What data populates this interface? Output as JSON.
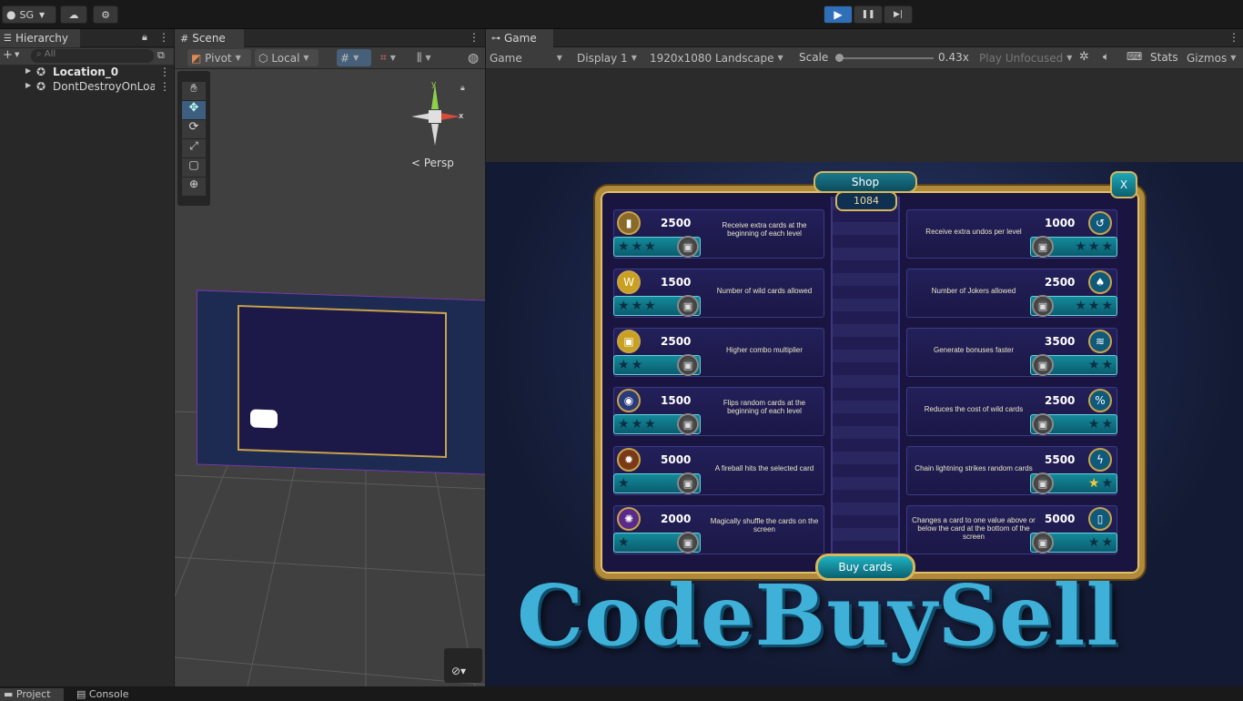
{
  "toolbar": {
    "account": "SG",
    "play": "▶",
    "pause": "❚❚",
    "step": "▶|"
  },
  "hierarchy": {
    "tab": "Hierarchy",
    "search_placeholder": "All",
    "items": [
      "Location_0",
      "DontDestroyOnLoad"
    ]
  },
  "scene": {
    "tab": "Scene",
    "pivot": "Pivot",
    "local": "Local",
    "persp": "< Persp",
    "axis_x": "x",
    "axis_y": "y"
  },
  "game": {
    "tab": "Game",
    "display_mode": "Game",
    "display": "Display 1",
    "resolution": "1920x1080 Landscape",
    "scale_label": "Scale",
    "scale_value": "0.43x",
    "play_focus": "Play Unfocused",
    "stats": "Stats",
    "gizmos": "Gizmos"
  },
  "shop": {
    "title": "Shop",
    "coins": "1084",
    "close": "X",
    "buy": "Buy cards",
    "left": [
      {
        "price": "2500",
        "desc": "Receive extra cards at the beginning of each level",
        "icon": "▮",
        "stars": 3
      },
      {
        "price": "1500",
        "desc": "Number of wild cards allowed",
        "icon": "W",
        "stars": 3
      },
      {
        "price": "2500",
        "desc": "Higher combo multiplier",
        "icon": "▣",
        "stars": 2
      },
      {
        "price": "1500",
        "desc": "Flips random cards at the beginning of each level",
        "icon": "◉",
        "stars": 3
      },
      {
        "price": "5000",
        "desc": "A fireball hits the selected card",
        "icon": "✹",
        "stars": 1
      },
      {
        "price": "2000",
        "desc": "Magically shuffle the cards on the screen",
        "icon": "✺",
        "stars": 1
      }
    ],
    "right": [
      {
        "price": "1000",
        "desc": "Receive extra undos per level",
        "icon": "↺",
        "stars": 3
      },
      {
        "price": "2500",
        "desc": "Number of Jokers allowed",
        "icon": "♠",
        "stars": 3
      },
      {
        "price": "3500",
        "desc": "Generate bonuses faster",
        "icon": "≋",
        "stars": 2
      },
      {
        "price": "2500",
        "desc": "Reduces the cost of wild cards",
        "icon": "%",
        "stars": 2
      },
      {
        "price": "5500",
        "desc": "Chain lightning strikes random cards",
        "icon": "ϟ",
        "stars": 2
      },
      {
        "price": "5000",
        "desc": "Changes a card to one value above or below the card at the bottom of the screen",
        "icon": "▯",
        "stars": 2
      }
    ]
  },
  "watermark": "CodeBuySell",
  "bottom": {
    "project": "Project",
    "console": "Console"
  },
  "colors": {
    "accent": "#2f7fd8",
    "teal": "#17a2b0",
    "gold": "#c9a34a"
  }
}
